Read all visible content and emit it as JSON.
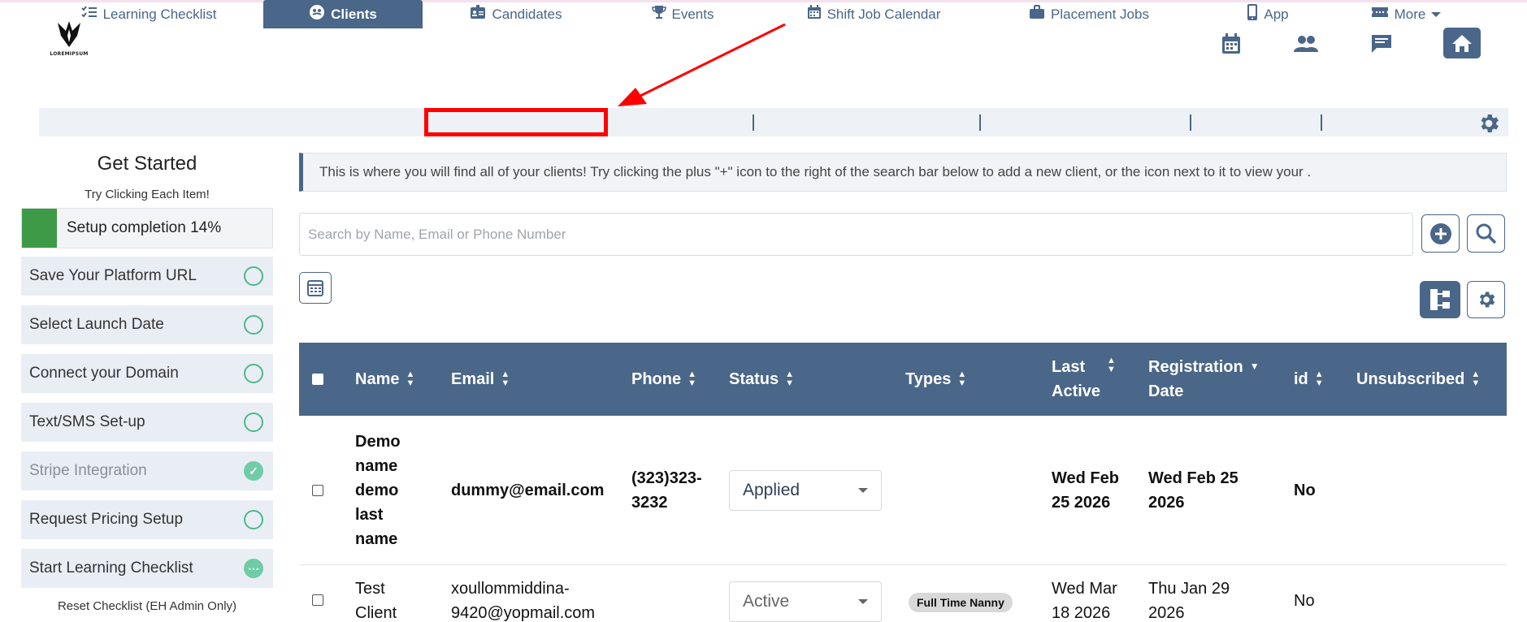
{
  "header": {
    "logo_text": "LOREMIPSUM",
    "icons": [
      "calendar-icon",
      "people-icon",
      "chat-icon",
      "home-icon"
    ]
  },
  "nav": {
    "items": [
      {
        "label": "Learning Checklist",
        "icon": "checklist-icon"
      },
      {
        "label": "Clients",
        "icon": "clients-icon",
        "active": true
      },
      {
        "label": "Candidates",
        "icon": "id-card-icon",
        "highlighted": true
      },
      {
        "label": "Events",
        "icon": "trophy-icon"
      },
      {
        "label": "Shift Job Calendar",
        "icon": "calendar-icon"
      },
      {
        "label": "Placement Jobs",
        "icon": "briefcase-icon"
      },
      {
        "label": "App",
        "icon": "phone-icon"
      },
      {
        "label": "More",
        "icon": "ticket-icon"
      }
    ]
  },
  "sidebar": {
    "title": "Get Started",
    "subtitle": "Try Clicking Each Item!",
    "progress_label": "Setup completion 14%",
    "progress_percent": 14,
    "items": [
      {
        "label": "Save Your Platform URL",
        "state": "open"
      },
      {
        "label": "Select Launch Date",
        "state": "open"
      },
      {
        "label": "Connect your Domain",
        "state": "open"
      },
      {
        "label": "Text/SMS Set-up",
        "state": "open"
      },
      {
        "label": "Stripe Integration",
        "state": "done"
      },
      {
        "label": "Request Pricing Setup",
        "state": "open"
      },
      {
        "label": "Start Learning Checklist",
        "state": "pending"
      }
    ],
    "reset_label": "Reset Checklist (EH Admin Only)"
  },
  "main": {
    "info_text": "This is where you will find all of your clients! Try clicking the plus \"+\" icon to the right of the search bar below to add a new client, or the icon next to it to view your .",
    "search_placeholder": "Search by Name, Email or Phone Number"
  },
  "table": {
    "headers": {
      "name": "Name",
      "email": "Email",
      "phone": "Phone",
      "status": "Status",
      "types": "Types",
      "last_active_1": "Last",
      "last_active_2": "Active",
      "reg_1": "Registration",
      "reg_2": "Date",
      "id": "id",
      "unsubscribed": "Unsubscribed"
    },
    "rows": [
      {
        "name_lines": [
          "Demo",
          "name",
          "demo",
          "last",
          "name"
        ],
        "email": "dummy@email.com",
        "phone_lines": [
          "(323)323-",
          "3232"
        ],
        "status": "Applied",
        "type": "",
        "last_active_lines": [
          "Wed Feb",
          "25 2026"
        ],
        "reg_lines": [
          "Wed Feb 25",
          "2026"
        ],
        "unsubscribed": "No"
      },
      {
        "name_lines": [
          "Test",
          "Client"
        ],
        "email_lines": [
          "xoullommiddina-",
          "9420@yopmail.com"
        ],
        "status": "Active",
        "type": "Full Time Nanny",
        "last_active_lines": [
          "Wed Mar",
          "18 2026"
        ],
        "reg_lines": [
          "Thu Jan 29",
          "2026"
        ],
        "unsubscribed": "No"
      }
    ]
  },
  "colors": {
    "primary": "#4a6688",
    "success": "#3f9a48",
    "check": "#4db889",
    "highlight": "#ff0000"
  }
}
